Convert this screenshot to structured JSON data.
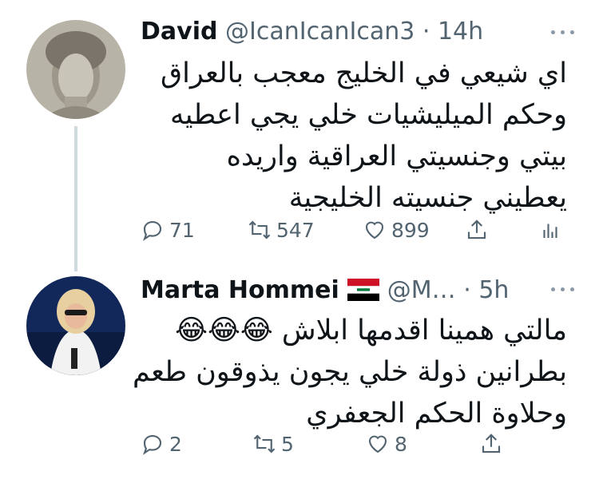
{
  "tweets": [
    {
      "name": "David",
      "handle": "@IcanIcanIcan3",
      "separator": "·",
      "time": "14h",
      "lines": [
        "اي شيعي في الخليج معجب بالعراق",
        "وحكم الميليشيات خلي يجي اعطيه",
        "بيتي وجنسيتي العراقية واريده",
        "يعطيني جنسيته الخليجية"
      ],
      "actions": {
        "replies": "71",
        "retweets": "547",
        "likes": "899"
      },
      "avatar_icon": "statue-avatar"
    },
    {
      "name": "Marta Hommei",
      "flag_icon": "iraq-flag-icon",
      "handle": "@M…",
      "separator": "·",
      "time": "5h",
      "lines": [
        "مالتي همينا اقدمها ابلاش 😂😂😂",
        "بطرانين ذولة خلي يجون يذوقون طعم",
        "وحلاوة الحكم الجعفري"
      ],
      "actions": {
        "replies": "2",
        "retweets": "5",
        "likes": "8"
      },
      "avatar_icon": "woman-avatar"
    }
  ],
  "colors": {
    "text": "#0f1419",
    "muted": "#536471",
    "thread": "#cfd9de"
  }
}
